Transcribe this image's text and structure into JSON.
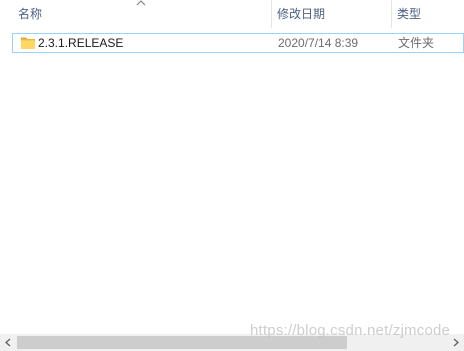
{
  "columns": {
    "name": "名称",
    "date_modified": "修改日期",
    "type": "类型"
  },
  "sort": {
    "column": "name",
    "direction": "ascending",
    "icon": "sort-up-icon"
  },
  "rows": [
    {
      "icon": "folder-icon",
      "name": "2.3.1.RELEASE",
      "date_modified": "2020/7/14 8:39",
      "type": "文件夹"
    }
  ],
  "scrollbar": {
    "left_icon": "scroll-left-icon",
    "right_icon": "scroll-right-icon"
  },
  "watermark": "https://blog.csdn.net/zjmcode",
  "colors": {
    "header_text": "#4d6082",
    "row_border": "#99d1ff",
    "folder_fill": "#ffd766",
    "folder_edge": "#e0a93b",
    "secondary_text": "#6d6d6d",
    "scrollbar_track": "#f0f0f0",
    "scrollbar_thumb": "#cdcdcd"
  }
}
